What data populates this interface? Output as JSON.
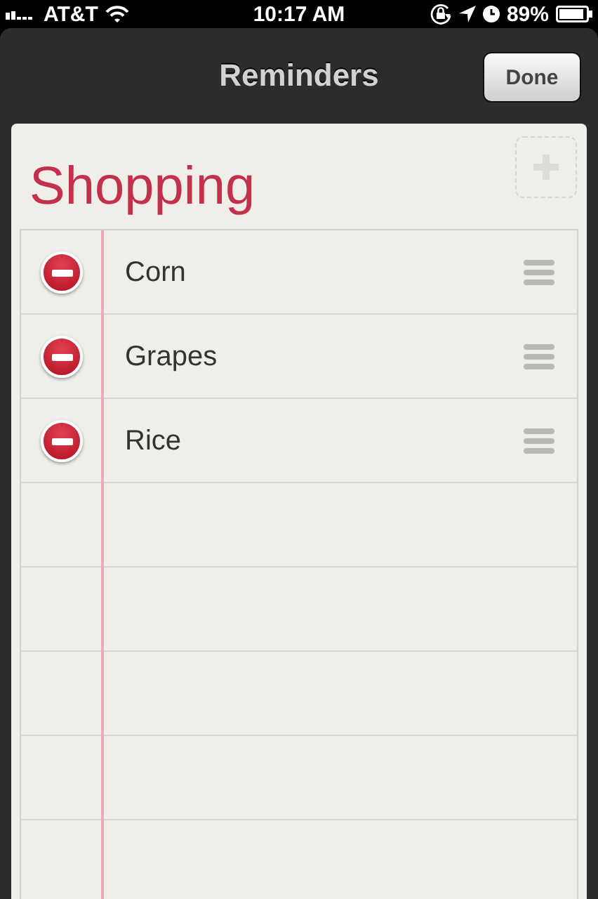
{
  "status_bar": {
    "carrier": "AT&T",
    "time": "10:17 AM",
    "battery": "89%"
  },
  "nav_bar": {
    "title": "Reminders",
    "done_button": "Done"
  },
  "list": {
    "title": "Shopping",
    "items": [
      {
        "text": "Corn"
      },
      {
        "text": "Grapes"
      },
      {
        "text": "Rice"
      }
    ]
  }
}
